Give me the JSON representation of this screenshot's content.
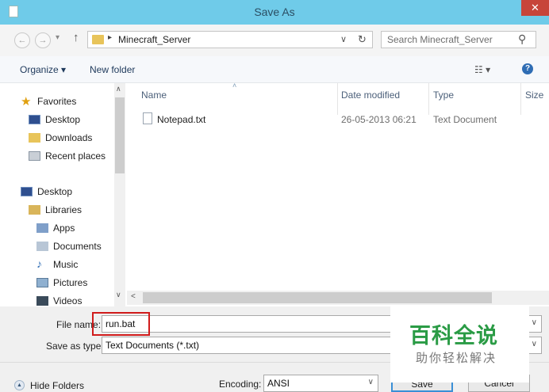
{
  "window": {
    "title": "Save As",
    "close_glyph": "✕"
  },
  "nav": {
    "back_glyph": "←",
    "forward_glyph": "→",
    "up_glyph": "↑",
    "address_separator": "▸",
    "address_path": "Minecraft_Server",
    "address_dropdown": "∨",
    "refresh_glyph": "↻",
    "search_placeholder": "Search Minecraft_Server",
    "search_icon": "⚲"
  },
  "toolbar": {
    "organize_label": "Organize ▾",
    "new_folder_label": "New folder",
    "view_glyph": "☷ ▾",
    "help_glyph": "?"
  },
  "sidebar": {
    "items": [
      {
        "label": "Favorites",
        "icon": "star-icon"
      },
      {
        "label": "Desktop",
        "icon": "desktop-icon"
      },
      {
        "label": "Downloads",
        "icon": "downloads-icon"
      },
      {
        "label": "Recent places",
        "icon": "recent-places-icon"
      },
      {
        "label": "Desktop",
        "icon": "desktop-icon"
      },
      {
        "label": "Libraries",
        "icon": "libraries-icon"
      },
      {
        "label": "Apps",
        "icon": "apps-icon"
      },
      {
        "label": "Documents",
        "icon": "documents-icon"
      },
      {
        "label": "Music",
        "icon": "music-icon"
      },
      {
        "label": "Pictures",
        "icon": "pictures-icon"
      },
      {
        "label": "Videos",
        "icon": "videos-icon"
      }
    ]
  },
  "columns": {
    "name": "Name",
    "date": "Date modified",
    "type": "Type",
    "size": "Size"
  },
  "files": [
    {
      "name": "Notepad.txt",
      "date": "26-05-2013 06:21",
      "type": "Text Document"
    }
  ],
  "bottom": {
    "file_name_label": "File name:",
    "file_name_value": "run.bat",
    "save_as_type_label": "Save as type:",
    "save_as_type_value": "Text Documents (*.txt)",
    "hide_folders_label": "Hide Folders",
    "encoding_label": "Encoding:",
    "encoding_value": "ANSI",
    "save_label": "Save",
    "cancel_label": "Cancel",
    "dropdown_glyph": "∨"
  },
  "watermark": {
    "text_big": "百科全说",
    "text_small": "助你轻松解决"
  },
  "colors": {
    "title_bar": "#6fcbe9",
    "close_button": "#c7453a",
    "highlight": "#d01b1b",
    "watermark_green": "#2a9b45"
  }
}
